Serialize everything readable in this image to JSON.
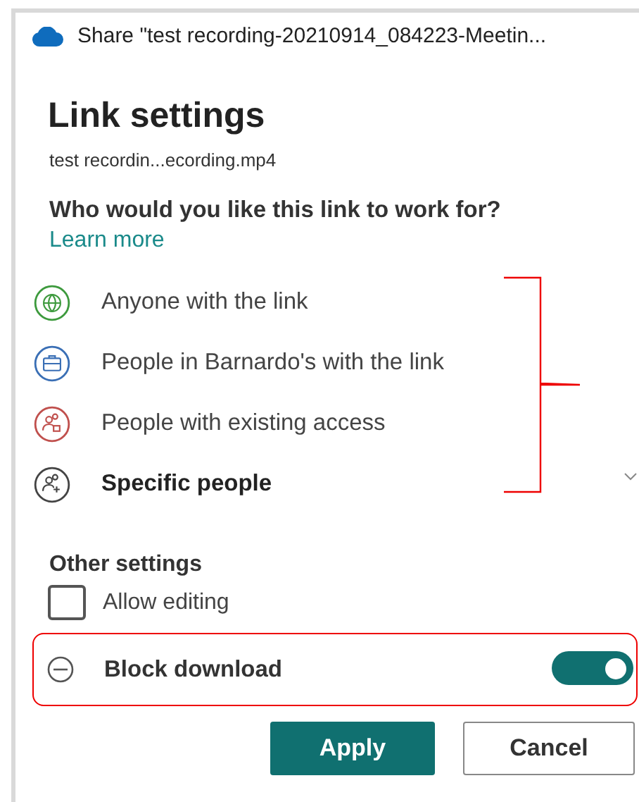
{
  "window": {
    "title": "Share \"test recording-20210914_084223-Meetin..."
  },
  "heading": "Link settings",
  "file_name": "test recordin...ecording.mp4",
  "question": "Who would you like this link to work for?",
  "learn_more": "Learn more",
  "options": [
    {
      "kind": "globe",
      "label": "Anyone with the link",
      "color": "#3d9a3d",
      "selected": false
    },
    {
      "kind": "briefcase",
      "label": "People in Barnardo's with the link",
      "color": "#3a6fb5",
      "selected": false
    },
    {
      "kind": "people-lock",
      "label": "People with existing access",
      "color": "#c0504d",
      "selected": false
    },
    {
      "kind": "people-add",
      "label": "Specific people",
      "color": "#444444",
      "selected": true
    }
  ],
  "other_settings": {
    "title": "Other settings",
    "items": [
      {
        "kind": "checkbox",
        "label": "Allow editing",
        "checked": false
      },
      {
        "kind": "toggle",
        "label": "Block download",
        "on": true
      }
    ]
  },
  "buttons": [
    {
      "kind": "primary",
      "label": "Apply"
    },
    {
      "kind": "secondary",
      "label": "Cancel"
    }
  ]
}
